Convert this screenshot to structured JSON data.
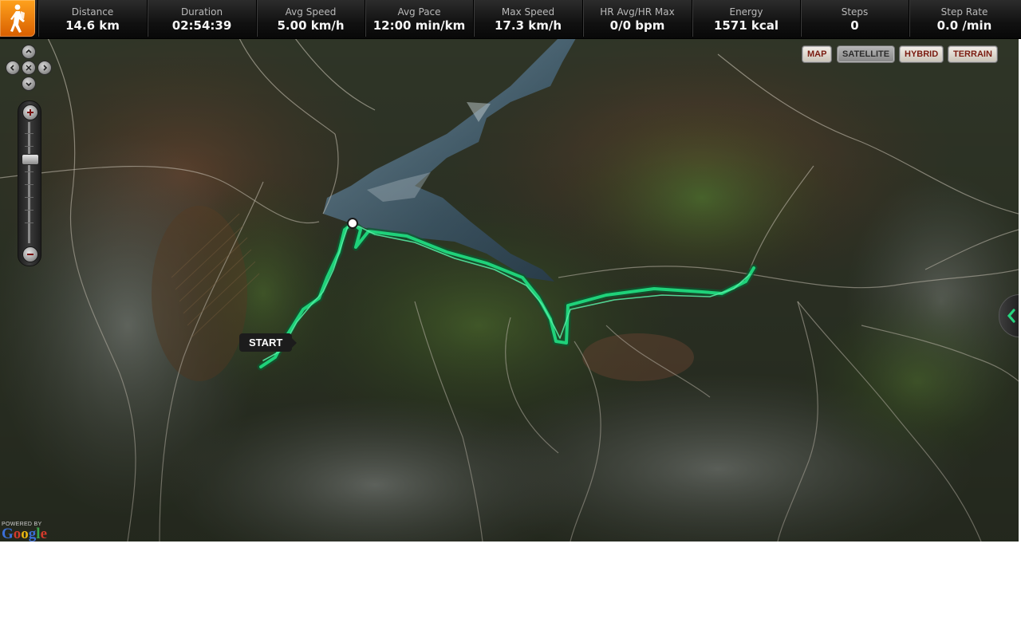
{
  "activity": {
    "icon": "hiker-icon",
    "badge_color": "#f08a12"
  },
  "stats": [
    {
      "label": "Distance",
      "value": "14.6 km"
    },
    {
      "label": "Duration",
      "value": "02:54:39"
    },
    {
      "label": "Avg Speed",
      "value": "5.00 km/h"
    },
    {
      "label": "Avg Pace",
      "value": "12:00 min/km"
    },
    {
      "label": "Max Speed",
      "value": "17.3 km/h"
    },
    {
      "label": "HR Avg/HR Max",
      "value": "0/0 bpm"
    },
    {
      "label": "Energy",
      "value": "1571 kcal"
    },
    {
      "label": "Steps",
      "value": "0"
    },
    {
      "label": "Step Rate",
      "value": "0.0 /min"
    }
  ],
  "map": {
    "types": [
      "MAP",
      "SATELLITE",
      "HYBRID",
      "TERRAIN"
    ],
    "active_type": "SATELLITE",
    "start_label": "START",
    "route_color": "#1fd27a",
    "attribution": {
      "powered_by": "POWERED BY",
      "logo_letters": [
        "G",
        "o",
        "o",
        "g",
        "l",
        "e"
      ]
    }
  },
  "icons": {
    "pan": [
      "pan-up-icon",
      "pan-left-icon",
      "pan-reset-icon",
      "pan-right-icon",
      "pan-down-icon"
    ],
    "zoom": [
      "zoom-in-icon",
      "zoom-out-icon"
    ],
    "panel_toggle": "chevron-left-icon"
  }
}
